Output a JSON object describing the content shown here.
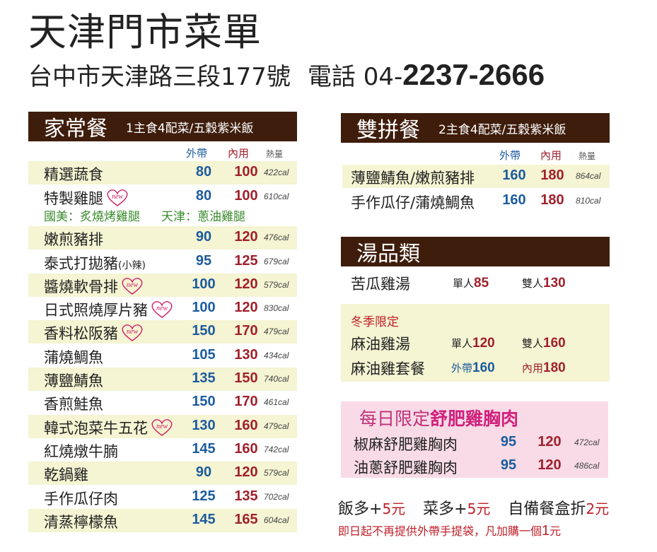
{
  "header": {
    "title": "天津門市菜單",
    "address": "台中市天津路三段177號",
    "phone_prefix": "電話 04-",
    "phone_number": "2237-2666"
  },
  "home_meal": {
    "title": "家常餐",
    "subtitle": "1主食4配菜/五穀紫米飯",
    "col_takeout": "外帶",
    "col_dine_in": "內用",
    "col_calories": "熱量",
    "items": [
      {
        "name": "精選蔬食",
        "takeout": "80",
        "dine_in": "100",
        "cal": "422cal",
        "new": false
      },
      {
        "name": "特製雞腿",
        "takeout": "80",
        "dine_in": "100",
        "cal": "610cal",
        "new": true
      },
      {
        "name": "嫩煎豬排",
        "takeout": "90",
        "dine_in": "120",
        "cal": "476cal",
        "new": false
      },
      {
        "name": "泰式打拋豬",
        "name_small": "(小辣)",
        "takeout": "95",
        "dine_in": "125",
        "cal": "679cal",
        "new": false
      },
      {
        "name": "醬燒軟骨排",
        "takeout": "100",
        "dine_in": "120",
        "cal": "579cal",
        "new": true
      },
      {
        "name": "日式照燒厚片豬",
        "takeout": "100",
        "dine_in": "120",
        "cal": "830cal",
        "new": true
      },
      {
        "name": "香料松阪豬",
        "takeout": "150",
        "dine_in": "170",
        "cal": "479cal",
        "new": true
      },
      {
        "name": "蒲燒鯛魚",
        "takeout": "105",
        "dine_in": "130",
        "cal": "434cal",
        "new": false
      },
      {
        "name": "薄鹽鯖魚",
        "takeout": "135",
        "dine_in": "150",
        "cal": "740cal",
        "new": false
      },
      {
        "name": "香煎鮭魚",
        "takeout": "150",
        "dine_in": "170",
        "cal": "461cal",
        "new": false
      },
      {
        "name": "韓式泡菜牛五花",
        "takeout": "130",
        "dine_in": "160",
        "cal": "479cal",
        "new": true
      },
      {
        "name": "紅燒燉牛腩",
        "takeout": "145",
        "dine_in": "160",
        "cal": "742cal",
        "new": false
      },
      {
        "name": "乾鍋雞",
        "takeout": "90",
        "dine_in": "120",
        "cal": "579cal",
        "new": false
      },
      {
        "name": "手作瓜仔肉",
        "takeout": "125",
        "dine_in": "135",
        "cal": "702cal",
        "new": false
      },
      {
        "name": "清蒸檸檬魚",
        "takeout": "145",
        "dine_in": "165",
        "cal": "604cal",
        "new": false
      }
    ],
    "chicken_note_1": "國美：炙燒烤雞腿",
    "chicken_note_2": "天津：蔥油雞腿",
    "new_badge": "new"
  },
  "double_meal": {
    "title": "雙拼餐",
    "subtitle": "2主食4配菜/五穀紫米飯",
    "col_takeout": "外帶",
    "col_dine_in": "內用",
    "col_calories": "熱量",
    "items": [
      {
        "name": "薄鹽鯖魚/嫩煎豬排",
        "takeout": "160",
        "dine_in": "180",
        "cal": "864cal"
      },
      {
        "name": "手作瓜仔/蒲燒鯛魚",
        "takeout": "160",
        "dine_in": "180",
        "cal": "810cal"
      }
    ]
  },
  "soup": {
    "title": "湯品類",
    "bitter_melon": {
      "name": "苦瓜雞湯",
      "single_label": "單人",
      "single_price": "85",
      "double_label": "雙人",
      "double_price": "130"
    },
    "winter_label": "冬季限定",
    "sesame_soup": {
      "name": "麻油雞湯",
      "single_label": "單人",
      "single_price": "120",
      "double_label": "雙人",
      "double_price": "160"
    },
    "sesame_set": {
      "name": "麻油雞套餐",
      "takeout_label": "外帶",
      "takeout_price": "160",
      "dine_in_label": "內用",
      "dine_in_price": "180"
    }
  },
  "daily": {
    "title_prefix": "每日限定",
    "title_bold": "舒肥雞胸肉",
    "items": [
      {
        "name": "椒麻舒肥雞胸肉",
        "takeout": "95",
        "dine_in": "120",
        "cal": "472cal"
      },
      {
        "name": "油蔥舒肥雞胸肉",
        "takeout": "95",
        "dine_in": "120",
        "cal": "486cal"
      }
    ]
  },
  "extras": {
    "rice_label": "飯多+",
    "rice_amt": "5元",
    "veg_label": "菜多+",
    "veg_amt": "5元",
    "box_label": "自備餐盒折",
    "box_amt": "2元"
  },
  "footnote": {
    "text": "即日起不再提供外帶手提袋，凡加購一個",
    "amount": "1",
    "unit": "元"
  },
  "colors": {
    "header_band": "#3f1d0c",
    "takeout": "#1c5c9e",
    "dine_in": "#a0202c",
    "band": "#f5f4d3",
    "pink_box": "#f8dbe6",
    "note_green": "#3a8b2c"
  }
}
